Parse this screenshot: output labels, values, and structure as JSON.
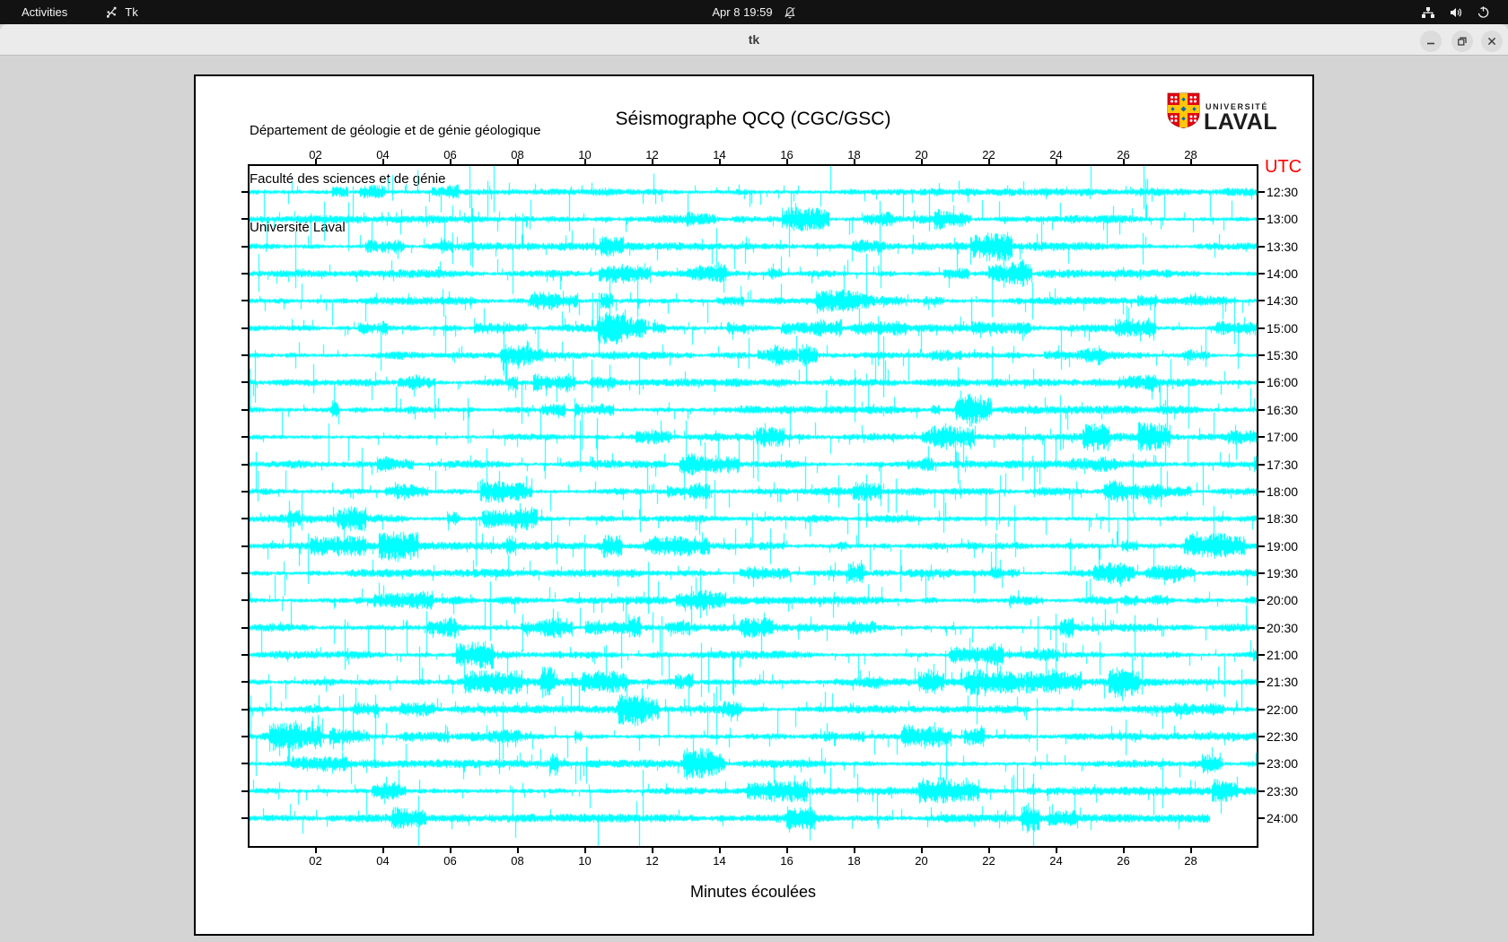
{
  "topbar": {
    "activities_label": "Activities",
    "app_name": "Tk",
    "clock": "Apr 8 19:59"
  },
  "titlebar": {
    "title": "tk"
  },
  "figure": {
    "institution_lines": [
      "Département de géologie et de génie géologique",
      "Faculté des sciences et de génie",
      "Université Laval"
    ],
    "title": "Séismographe QCQ (CGC/GSC)",
    "logo_text_small": "UNIVERSITÉ",
    "logo_text_large": "LAVAL",
    "utc_label": "UTC",
    "x_axis_label": "Minutes écoulées"
  },
  "chart_data": {
    "type": "line",
    "subtype": "helicorder-seismogram",
    "title": "Séismographe QCQ (CGC/GSC)",
    "station": "QCQ (CGC/GSC)",
    "xlabel": "Minutes écoulées",
    "right_axis_label": "UTC",
    "x_range_minutes": [
      0,
      30
    ],
    "x_tick_minutes": [
      2,
      4,
      6,
      8,
      10,
      12,
      14,
      16,
      18,
      20,
      22,
      24,
      26,
      28
    ],
    "x_tick_labels": [
      "02",
      "04",
      "06",
      "08",
      "10",
      "12",
      "14",
      "16",
      "18",
      "20",
      "22",
      "24",
      "26",
      "28"
    ],
    "row_labels_utc": [
      "12:30",
      "13:00",
      "13:30",
      "14:00",
      "14:30",
      "15:00",
      "15:30",
      "16:00",
      "16:30",
      "17:00",
      "17:30",
      "18:00",
      "18:30",
      "19:00",
      "19:30",
      "20:00",
      "20:30",
      "21:00",
      "21:30",
      "22:00",
      "22:30",
      "23:00",
      "23:30",
      "24:00"
    ],
    "minutes_per_row": 30,
    "rows": 24,
    "trace_color": "#00ffff",
    "axis_color": "#000000",
    "utc_label_color": "#ff0000",
    "background": "#ffffff",
    "last_row_end_fraction": 0.954,
    "grid": false,
    "description": "Continuous seismic drum recording: 24 half-hour rows of cyan noise traces with irregular spikes; the final row (24:00) stops at about minute 28.6."
  },
  "logo_colors": {
    "shield_red": "#e30513",
    "cross_gold": "#ffc60b",
    "accent_blue": "#0067b1"
  }
}
